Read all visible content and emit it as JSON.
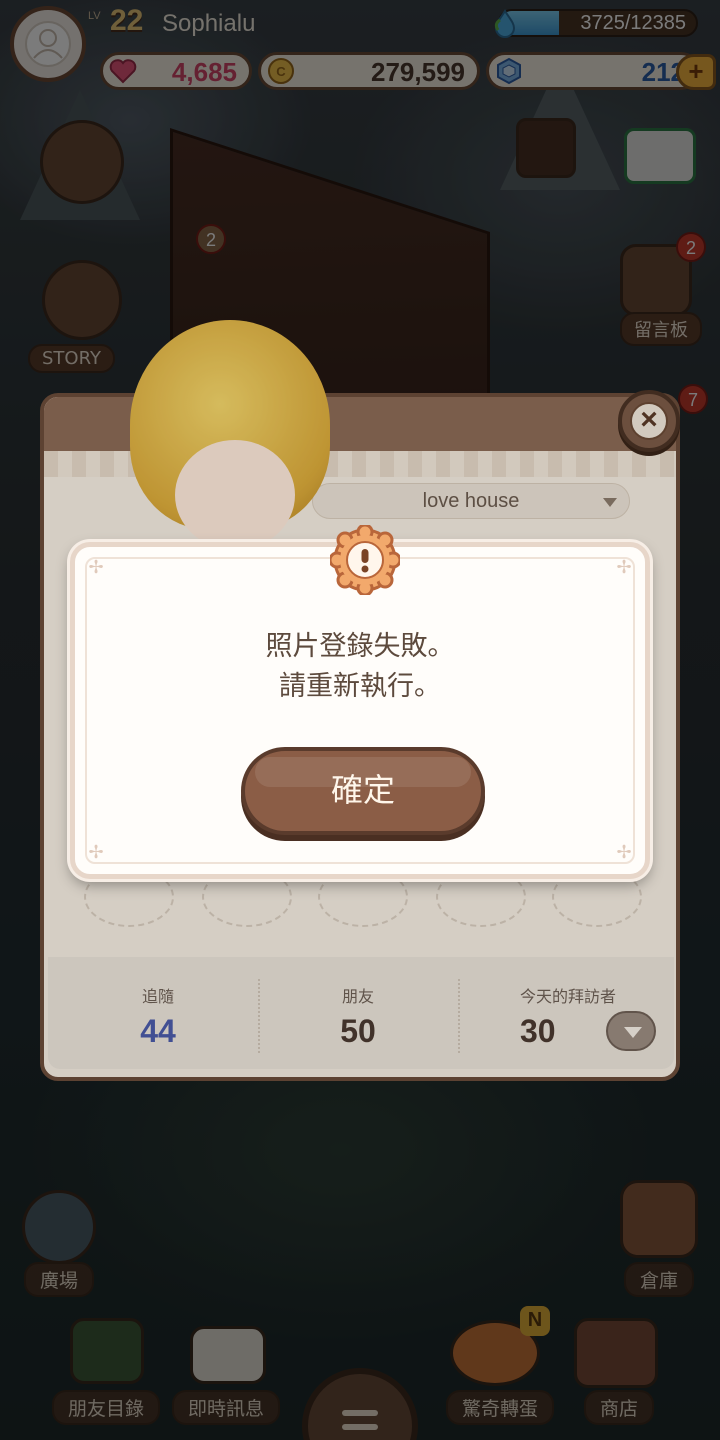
{
  "player": {
    "level_label": "LV",
    "level": "22",
    "name": "Sophialu",
    "exp_text": "3725/12385",
    "exp_fraction": 0.3
  },
  "currency": {
    "hearts": "4,685",
    "coins": "279,599",
    "gems": "212",
    "plus": "+"
  },
  "map_buttons": {
    "story": "STORY",
    "guestbook": "留言板",
    "guestbook_badge": "2",
    "event_badge": "2",
    "side_badge": "7",
    "plaza": "廣場",
    "storage": "倉庫"
  },
  "profile": {
    "house_name": "love house",
    "stats": [
      {
        "label": "追隨",
        "value": "44",
        "color": "#4a5aa8"
      },
      {
        "label": "朋友",
        "value": "50",
        "color": "#4b3a30"
      },
      {
        "label": "今天的拜訪者",
        "value": "30",
        "color": "#4b3a30"
      }
    ]
  },
  "dialog": {
    "line1": "照片登錄失敗。",
    "line2": "請重新執行。",
    "confirm": "確定"
  },
  "bottom_nav": {
    "friends_list": "朋友目錄",
    "messages": "即時訊息",
    "surprise_egg": "驚奇轉蛋",
    "shop": "商店",
    "new_badge": "N"
  },
  "colors": {
    "accent_brown": "#8b5d46",
    "heart": "#d4456b",
    "gem": "#2f5fa8",
    "follow": "#4a5aa8"
  }
}
